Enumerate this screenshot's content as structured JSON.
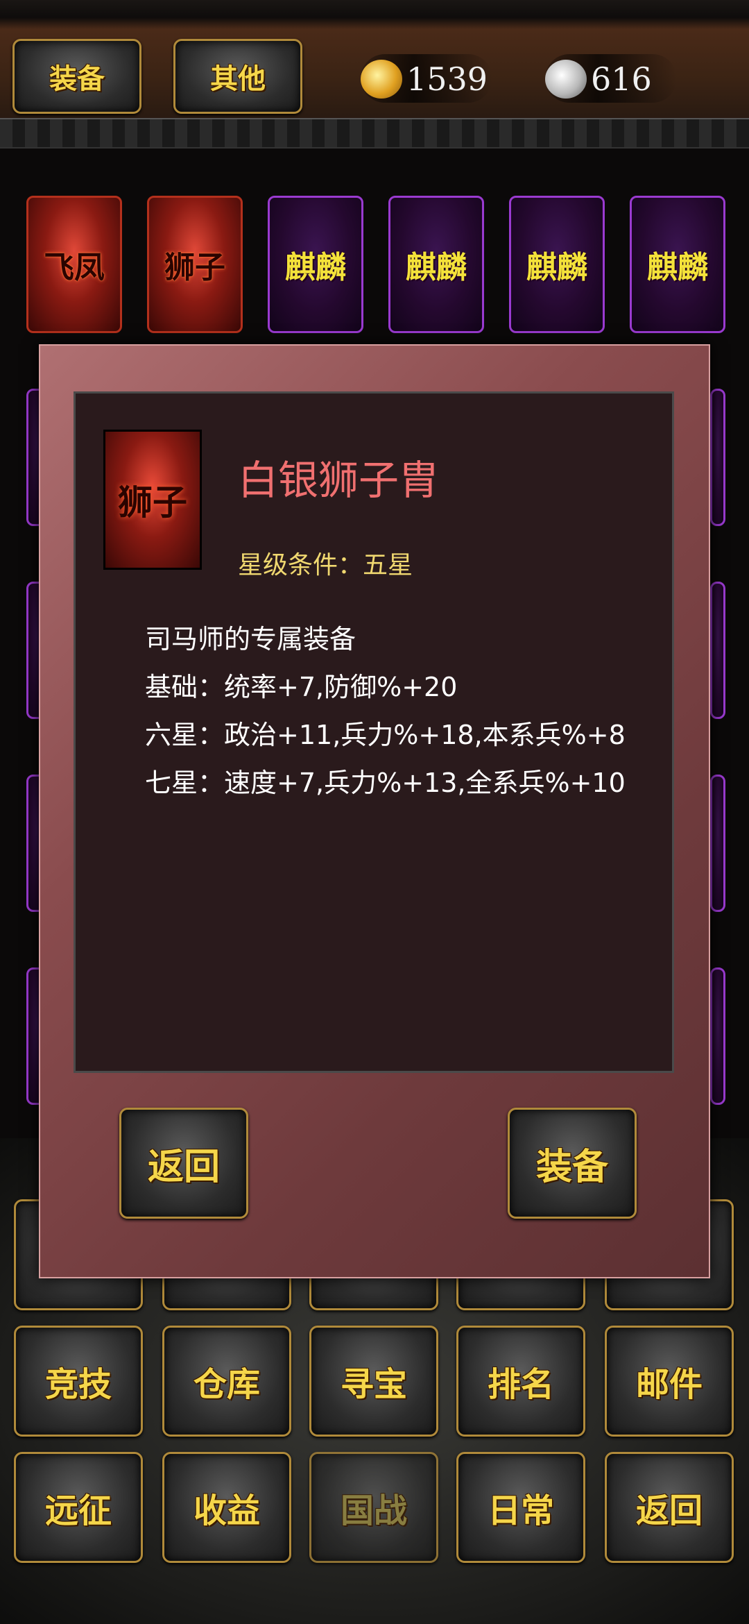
{
  "topbar": {
    "tab_equip": "装备",
    "tab_other": "其他",
    "gold": "1539",
    "silver": "616"
  },
  "cards": [
    {
      "label": "飞凤",
      "rarity": "red"
    },
    {
      "label": "狮子",
      "rarity": "red"
    },
    {
      "label": "麒麟",
      "rarity": "purple"
    },
    {
      "label": "麒麟",
      "rarity": "purple"
    },
    {
      "label": "麒麟",
      "rarity": "purple"
    },
    {
      "label": "麒麟",
      "rarity": "purple"
    }
  ],
  "modal": {
    "item_icon_label": "狮子",
    "item_name": "白银狮子胄",
    "star_condition": "星级条件：五星",
    "desc_lines": [
      "司马师的专属装备",
      "基础：统率+7,防御%+20",
      "六星：政治+11,兵力%+18,本系兵%+8",
      "七星：速度+7,兵力%+13,全系兵%+10"
    ],
    "back_button": "返回",
    "equip_button": "装备"
  },
  "menu": {
    "row2": [
      "竞技",
      "仓库",
      "寻宝",
      "排名",
      "邮件"
    ],
    "row3": [
      "远征",
      "收益",
      "国战",
      "日常",
      "返回"
    ]
  },
  "colors": {
    "button_text": "#f5d64a",
    "button_border": "#b08a3a",
    "item_name": "#f07070",
    "star_text": "#f0d870"
  }
}
